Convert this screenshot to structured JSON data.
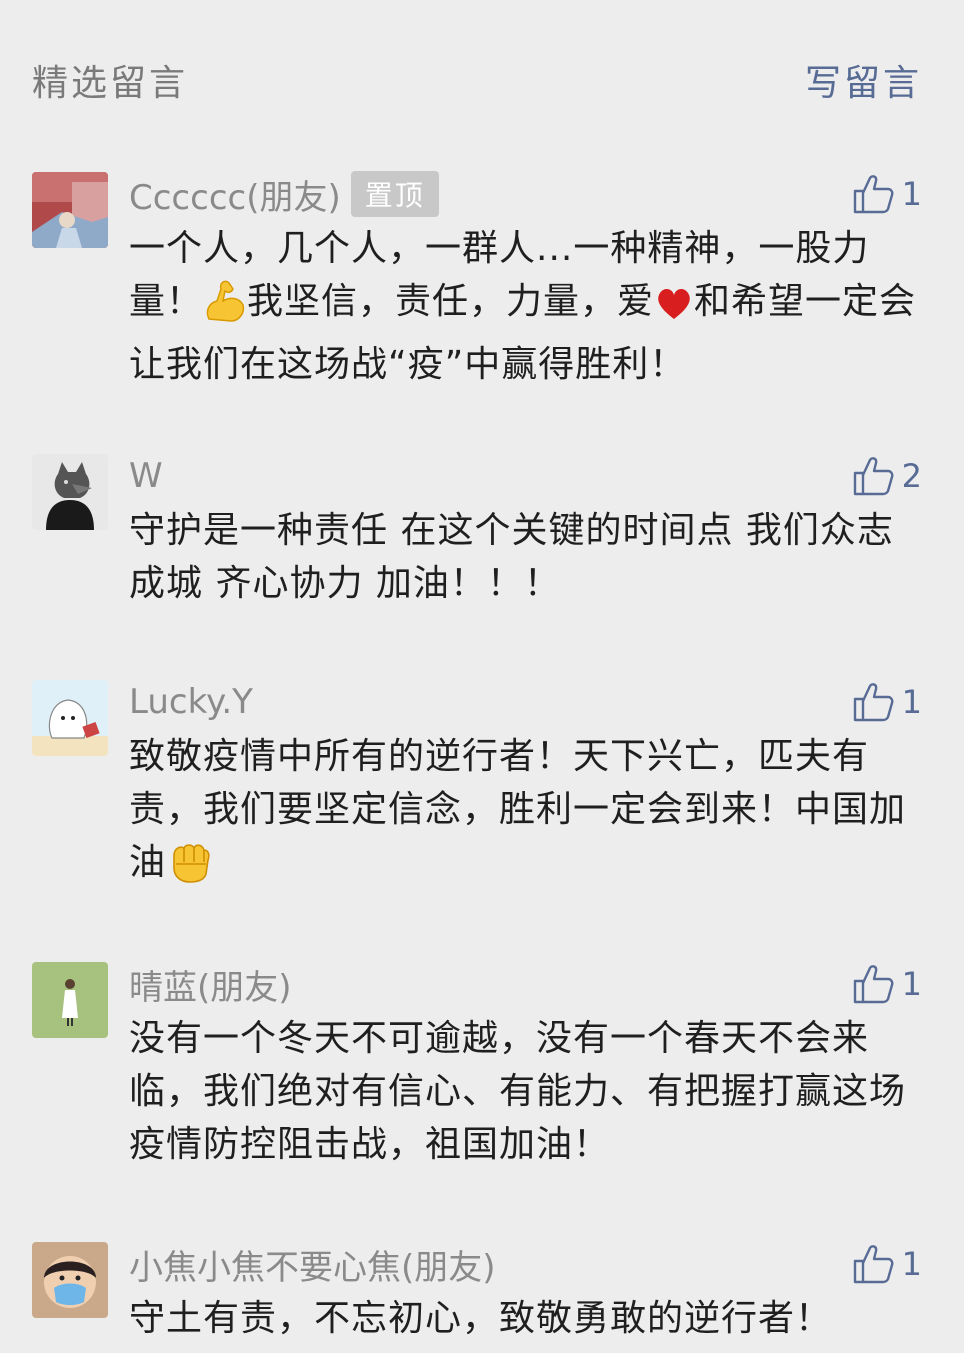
{
  "header": {
    "title": "精选留言",
    "write_label": "写留言"
  },
  "comments": [
    {
      "nickname": "Cccccc(朋友)",
      "pinned_label": "置顶",
      "likes": "1",
      "text_a": "一个人，几个人，一群人...一种精神，一股力量！",
      "text_b": "我坚信，责任，力量，爱",
      "text_c": "和希望一定会让我们在这场战“疫”中赢得胜利！",
      "emoji_1": "flexed-biceps",
      "emoji_2": "red-heart"
    },
    {
      "nickname": "W",
      "likes": "2",
      "text": "守护是一种责任 在这个关键的时间点 我们众志成城 齐心协力 加油！！！"
    },
    {
      "nickname": "Lucky.Y",
      "likes": "1",
      "text": "致敬疫情中所有的逆行者！天下兴亡，匹夫有责，我们要坚定信念，胜利一定会到来！中国加油",
      "emoji": "raised-fist"
    },
    {
      "nickname": "晴蓝(朋友)",
      "likes": "1",
      "text": "没有一个冬天不可逾越，没有一个春天不会来临，我们绝对有信心、有能力、有把握打赢这场疫情防控阻击战，祖国加油！"
    },
    {
      "nickname": "小焦小焦不要心焦(朋友)",
      "likes": "1",
      "text": "守土有责，不忘初心，致敬勇敢的逆行者！"
    }
  ],
  "colors": {
    "accent": "#586b95",
    "background": "#ededed",
    "nickname": "#8a8a8a"
  }
}
